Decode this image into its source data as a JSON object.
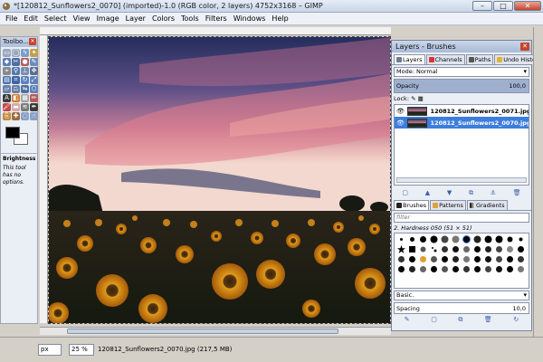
{
  "window": {
    "title": "*[120812_Sunflowers2_0070] (imported)-1.0 (RGB color, 2 layers) 4752x3168 – GIMP",
    "min_label": "–",
    "max_label": "□",
    "close_label": "✕"
  },
  "menu": [
    "File",
    "Edit",
    "Select",
    "View",
    "Image",
    "Layer",
    "Colors",
    "Tools",
    "Filters",
    "Windows",
    "Help"
  ],
  "toolbox": {
    "title": "Toolbo...",
    "close": "✕",
    "tool_options_name": "Brightness-C",
    "tool_options_note": "This tool has no options."
  },
  "statusbar": {
    "unit": "px",
    "zoom": "25 %",
    "info": "120812_Sunflowers2_0070.jpg (217,5 MB)"
  },
  "dock": {
    "title": "Layers - Brushes",
    "close": "✕",
    "tabs": [
      "Layers",
      "Channels",
      "Paths",
      "Undo History"
    ],
    "mode": "Mode: Normal",
    "opacity_label": "Opacity",
    "opacity_value": "100,0",
    "lock_label": "Lock:",
    "layers": [
      {
        "name": "120812_Sunflowers2_0071.jpg",
        "selected": false
      },
      {
        "name": "120812_Sunflowers2_0070.jpg",
        "selected": true
      }
    ],
    "brush_tabs": [
      "Brushes",
      "Patterns",
      "Gradients"
    ],
    "filter_placeholder": "filter",
    "brush_name": "2. Hardness 050 (51 × 51)",
    "preset": "Basic.",
    "spacing_label": "Spacing",
    "spacing_value": "10,0"
  },
  "colors": {
    "accent": "#3d7ddd",
    "titlebar": "#c9d6ea"
  }
}
